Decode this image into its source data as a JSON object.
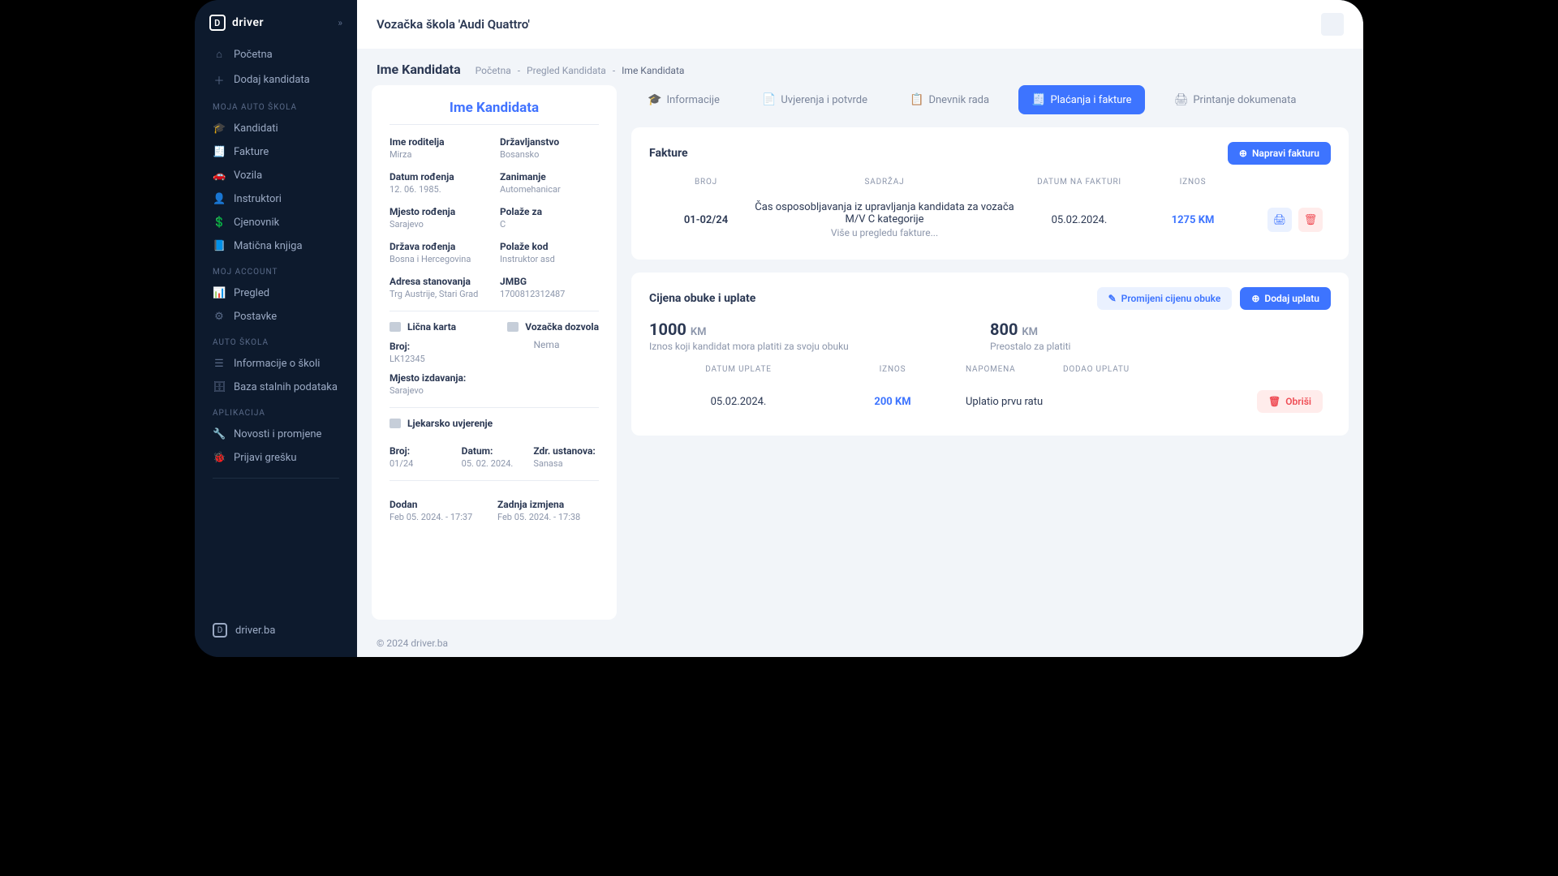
{
  "brand": "driver",
  "brandLink": "driver.ba",
  "header": {
    "title": "Vozačka škola 'Audi Quattro'"
  },
  "breadcrumb": {
    "pageTitle": "Ime Kandidata",
    "items": [
      "Početna",
      "Pregled Kandidata",
      "Ime Kandidata"
    ]
  },
  "sidebar": {
    "top": [
      {
        "icon": "⌂",
        "label": "Početna"
      },
      {
        "icon": "＋",
        "label": "Dodaj kandidata"
      }
    ],
    "groups": [
      {
        "label": "MOJA AUTO ŠKOLA",
        "items": [
          {
            "icon": "🎓",
            "label": "Kandidati"
          },
          {
            "icon": "🧾",
            "label": "Fakture"
          },
          {
            "icon": "🚗",
            "label": "Vozila"
          },
          {
            "icon": "👤",
            "label": "Instruktori"
          },
          {
            "icon": "💲",
            "label": "Cjenovnik"
          },
          {
            "icon": "📘",
            "label": "Matična knjiga"
          }
        ]
      },
      {
        "label": "MOJ ACCOUNT",
        "items": [
          {
            "icon": "📊",
            "label": "Pregled"
          },
          {
            "icon": "⚙",
            "label": "Postavke"
          }
        ]
      },
      {
        "label": "AUTO ŠKOLA",
        "items": [
          {
            "icon": "☰",
            "label": "Informacije o školi"
          },
          {
            "icon": "🗄",
            "label": "Baza stalnih podataka"
          }
        ]
      },
      {
        "label": "APLIKACIJA",
        "items": [
          {
            "icon": "🔧",
            "label": "Novosti i promjene"
          },
          {
            "icon": "🐞",
            "label": "Prijavi grešku"
          }
        ]
      }
    ]
  },
  "candidate": {
    "title": "Ime Kandidata",
    "fields": [
      {
        "lbl": "Ime roditelja",
        "val": "Mirza"
      },
      {
        "lbl": "Državljanstvo",
        "val": "Bosansko"
      },
      {
        "lbl": "Datum rođenja",
        "val": "12. 06. 1985."
      },
      {
        "lbl": "Zanimanje",
        "val": "Automehanicar"
      },
      {
        "lbl": "Mjesto rođenja",
        "val": "Sarajevo"
      },
      {
        "lbl": "Polaže za",
        "val": "C"
      },
      {
        "lbl": "Država rođenja",
        "val": "Bosna i Hercegovina"
      },
      {
        "lbl": "Polaže kod",
        "val": "Instruktor asd"
      },
      {
        "lbl": "Adresa stanovanja",
        "val": "Trg Austrije, Stari Grad"
      },
      {
        "lbl": "JMBG",
        "val": "1700812312487"
      }
    ],
    "idCardTitle": "Lična karta",
    "licenseTitle": "Vozačka dozvola",
    "licenseNone": "Nema",
    "idNumberLbl": "Broj:",
    "idNumber": "LK12345",
    "idPlaceLbl": "Mjesto izdavanja:",
    "idPlace": "Sarajevo",
    "medTitle": "Ljekarsko uvjerenje",
    "med": {
      "numLbl": "Broj:",
      "num": "01/24",
      "dateLbl": "Datum:",
      "date": "05. 02. 2024.",
      "instLbl": "Zdr. ustanova:",
      "inst": "Sanasa"
    },
    "added": {
      "lbl": "Dodan",
      "val": "Feb 05. 2024. - 17:37"
    },
    "edited": {
      "lbl": "Zadnja izmjena",
      "val": "Feb 05. 2024. - 17:38"
    }
  },
  "tabs": [
    {
      "icon": "🎓",
      "label": "Informacije"
    },
    {
      "icon": "📄",
      "label": "Uvjerenja i potvrde"
    },
    {
      "icon": "📋",
      "label": "Dnevnik rada"
    },
    {
      "icon": "🧾",
      "label": "Plaćanja i fakture"
    },
    {
      "icon": "🖨",
      "label": "Printanje dokumenata"
    }
  ],
  "invoices": {
    "title": "Fakture",
    "createBtn": "Napravi fakturu",
    "headers": {
      "num": "BROJ",
      "content": "SADRŽAJ",
      "date": "DATUM NA FAKTURI",
      "amount": "IZNOS"
    },
    "rows": [
      {
        "num": "01-02/24",
        "desc": "Čas osposobljavanja iz upravljanja kandidata za vozača M/V C kategorije",
        "sub": "Više u pregledu fakture...",
        "date": "05.02.2024.",
        "amount": "1275 KM"
      }
    ]
  },
  "training": {
    "title": "Cijena obuke i uplate",
    "changeBtn": "Promijeni cijenu obuke",
    "addBtn": "Dodaj uplatu",
    "total": {
      "val": "1000",
      "cur": "KM",
      "sub": "Iznos koji kandidat mora platiti za svoju obuku"
    },
    "remaining": {
      "val": "800",
      "cur": "KM",
      "sub": "Preostalo za platiti"
    },
    "headers": {
      "date": "DATUM UPLATE",
      "amount": "IZNOS",
      "note": "NAPOMENA",
      "added": "DODAO UPLATU"
    },
    "rows": [
      {
        "date": "05.02.2024.",
        "amount": "200 KM",
        "note": "Uplatio prvu ratu",
        "delLabel": "Obriši"
      }
    ]
  },
  "footer": "© 2024 driver.ba"
}
